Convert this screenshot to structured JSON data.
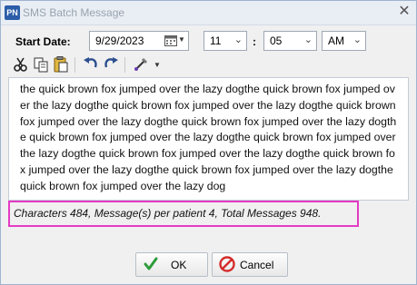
{
  "window": {
    "title": "SMS Batch Message",
    "app_icon_text": "PN",
    "close_glyph": "✕"
  },
  "schedule": {
    "start_date_label": "Start Date:",
    "date_value": "9/29/2023",
    "hour_value": "11",
    "minute_value": "05",
    "ampm_value": "AM",
    "time_separator": ":"
  },
  "toolbar": {
    "items": [
      "cut-icon",
      "copy-icon",
      "paste-icon",
      "undo-icon",
      "redo-icon",
      "spell-check-icon"
    ]
  },
  "message": {
    "text": "the quick brown fox jumped over the lazy dogthe quick brown fox jumped over the lazy dogthe quick brown fox jumped over the lazy dogthe quick brown fox jumped over the lazy dogthe quick brown fox jumped over the lazy dogthe quick brown fox jumped over the lazy dogthe quick brown fox jumped over the lazy dogthe quick brown fox jumped over the lazy dogthe quick brown fox jumped over the lazy dogthe quick brown fox jumped over the lazy dogthe quick brown fox jumped over the lazy dog"
  },
  "status": {
    "text": "Characters 484, Message(s) per patient 4, Total Messages 948."
  },
  "buttons": {
    "ok_label": "OK",
    "cancel_label": "Cancel"
  },
  "colors": {
    "highlight_border": "#e43bc5",
    "ok_check": "#2e9c3a",
    "cancel_red": "#d42b2b"
  }
}
